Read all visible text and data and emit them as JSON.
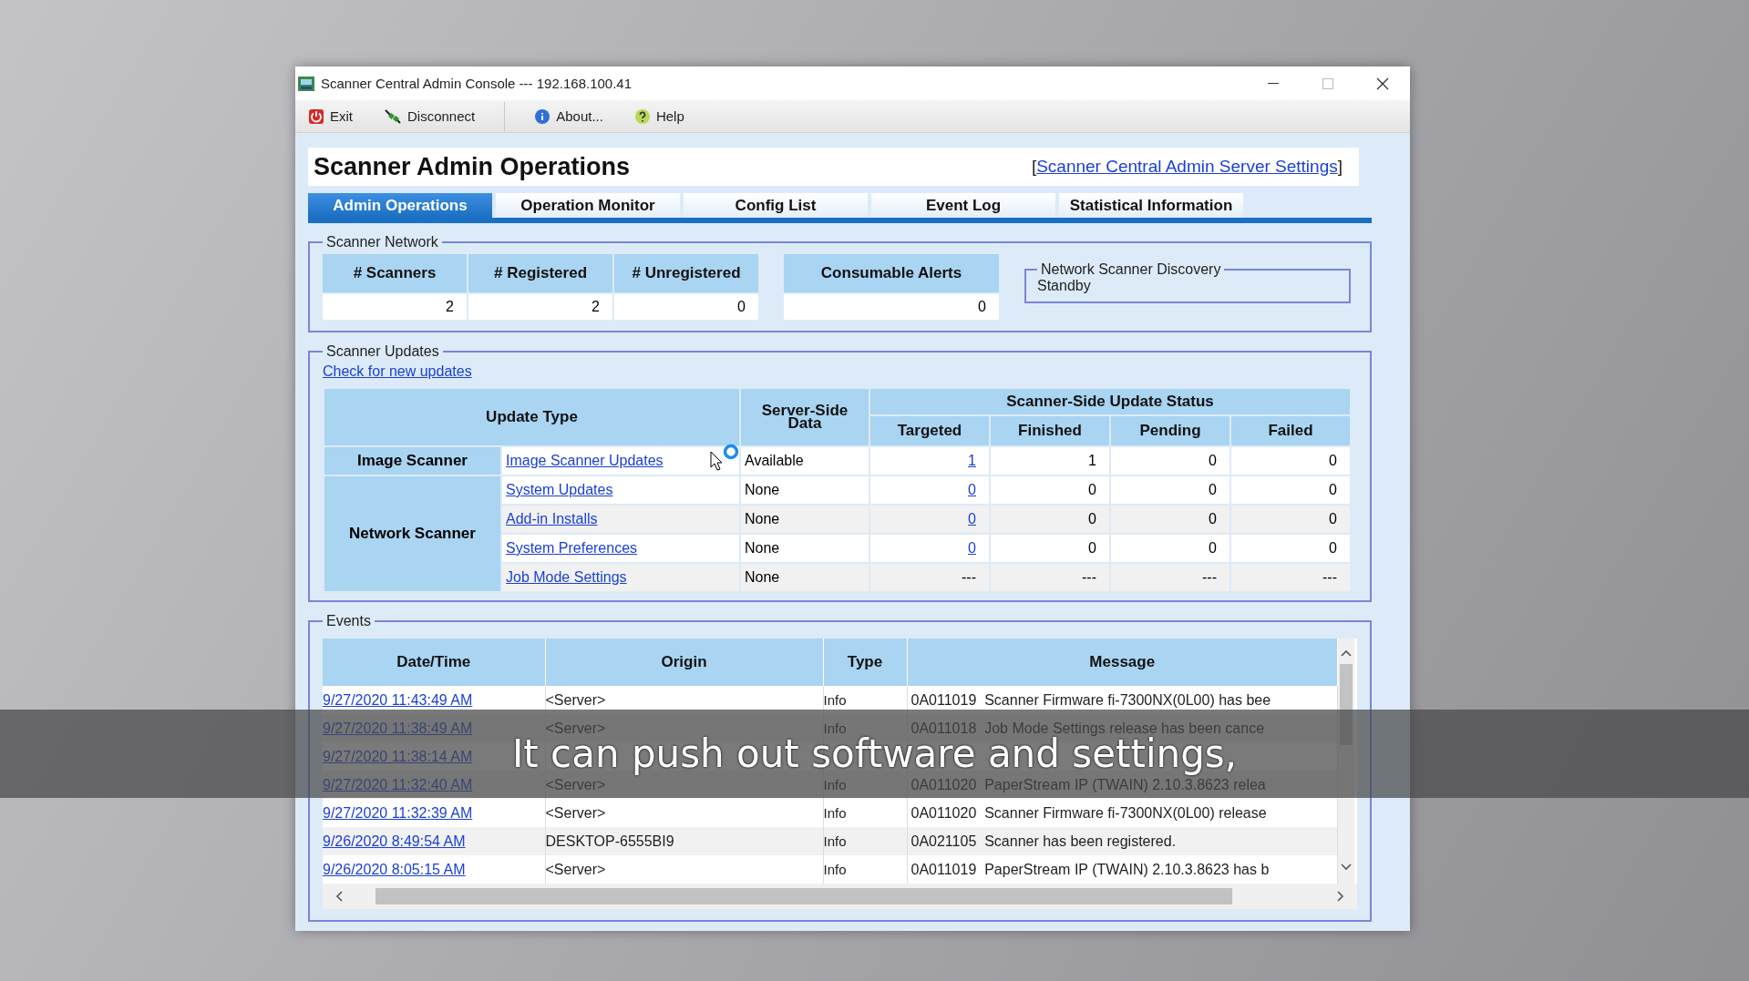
{
  "window": {
    "title": "Scanner Central Admin Console --- 192.168.100.41"
  },
  "toolbar": {
    "groups": [
      [
        {
          "label": "Exit"
        },
        {
          "label": "Disconnect"
        }
      ],
      [
        {
          "label": "About..."
        },
        {
          "label": "Help"
        }
      ]
    ]
  },
  "page_title": "Scanner Admin Operations",
  "settings_link": {
    "open": "[",
    "label": "Scanner Central Admin Server Settings",
    "close": "]"
  },
  "tabs": [
    {
      "label": "Admin Operations",
      "selected": true
    },
    {
      "label": "Operation Monitor",
      "selected": false
    },
    {
      "label": "Config List",
      "selected": false
    },
    {
      "label": "Event Log",
      "selected": false
    },
    {
      "label": "Statistical Information",
      "selected": false
    }
  ],
  "scanner_network": {
    "legend": "Scanner Network",
    "counts": [
      {
        "label": "# Scanners",
        "value": "2"
      },
      {
        "label": "# Registered",
        "value": "2"
      },
      {
        "label": "# Unregistered",
        "value": "0"
      }
    ],
    "alerts": {
      "label": "Consumable Alerts",
      "value": "0"
    },
    "discovery": {
      "legend": "Network Scanner Discovery",
      "status": "Standby"
    }
  },
  "scanner_updates": {
    "legend": "Scanner Updates",
    "check_link": "Check for new updates",
    "headers": {
      "update_type": "Update Type",
      "server_side": "Server-Side Data",
      "status": "Scanner-Side Update Status",
      "status_columns": [
        "Targeted",
        "Finished",
        "Pending",
        "Failed"
      ]
    },
    "groups": [
      {
        "name": "Image Scanner",
        "rows": [
          {
            "update": "Image Scanner Updates",
            "server": "Available",
            "targeted": "1",
            "targeted_link": true,
            "finished": "1",
            "pending": "0",
            "failed": "0",
            "busy": true
          }
        ]
      },
      {
        "name": "Network Scanner",
        "rows": [
          {
            "update": "System Updates",
            "server": "None",
            "targeted": "0",
            "targeted_link": true,
            "finished": "0",
            "pending": "0",
            "failed": "0",
            "busy": false
          },
          {
            "update": "Add-in Installs",
            "server": "None",
            "targeted": "0",
            "targeted_link": true,
            "finished": "0",
            "pending": "0",
            "failed": "0",
            "busy": false
          },
          {
            "update": "System Preferences",
            "server": "None",
            "targeted": "0",
            "targeted_link": true,
            "finished": "0",
            "pending": "0",
            "failed": "0",
            "busy": false
          },
          {
            "update": "Job Mode Settings",
            "server": "None",
            "targeted": "---",
            "targeted_link": false,
            "finished": "---",
            "pending": "---",
            "failed": "---",
            "busy": false
          }
        ]
      }
    ]
  },
  "events": {
    "legend": "Events",
    "columns": [
      "Date/Time",
      "Origin",
      "Type",
      "Message"
    ],
    "rows": [
      {
        "date": "9/27/2020 11:43:49 AM",
        "origin": "<Server>",
        "type": "Info",
        "message": "0A011019  Scanner Firmware fi-7300NX(0L00) has bee"
      },
      {
        "date": "9/27/2020 11:38:49 AM",
        "origin": "<Server>",
        "type": "Info",
        "message": "0A011018  Job Mode Settings release has been cance"
      },
      {
        "date": "9/27/2020 11:38:14 AM"
      },
      {
        "date": "9/27/2020 11:32:40 AM",
        "origin": "<Server>",
        "type": "Info",
        "message": "0A011020  PaperStream IP (TWAIN) 2.10.3.8623 relea"
      },
      {
        "date": "9/27/2020 11:32:39 AM",
        "origin": "<Server>",
        "type": "Info",
        "message": "0A011020  Scanner Firmware fi-7300NX(0L00) release"
      },
      {
        "date": "9/26/2020 8:49:54 AM",
        "origin": "DESKTOP-6555BI9",
        "type": "Info",
        "message": "0A021105  Scanner has been registered."
      },
      {
        "date": "9/26/2020 8:05:15 AM",
        "origin": "<Server>",
        "type": "Info",
        "message": "0A011019  PaperStream IP (TWAIN) 2.10.3.8623 has b"
      }
    ]
  },
  "caption": "It can push out software and settings,"
}
